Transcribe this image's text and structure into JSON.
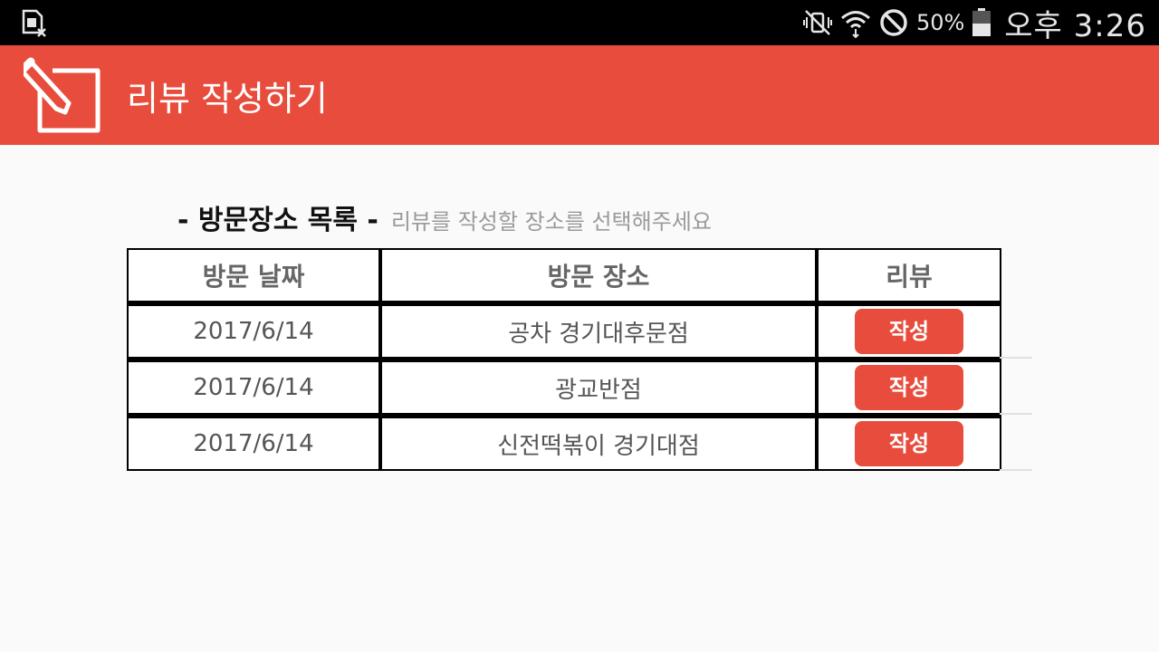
{
  "status_bar": {
    "battery_percent": "50%",
    "time": "오후 3:26",
    "icons": [
      "sim-card-missing-icon",
      "vibrate-mute-icon",
      "wifi-icon",
      "do-not-disturb-icon",
      "battery-icon"
    ]
  },
  "app_bar": {
    "title": "리뷰 작성하기",
    "icon": "edit-note-icon",
    "color": "#e84c3d"
  },
  "list": {
    "title": "- 방문장소 목록 -",
    "hint": "리뷰를 작성할 장소를 선택해주세요",
    "columns": [
      "방문 날짜",
      "방문 장소",
      "리뷰"
    ],
    "rows": [
      {
        "date": "2017/6/14",
        "place": "공차 경기대후문점",
        "action": "작성"
      },
      {
        "date": "2017/6/14",
        "place": "광교반점",
        "action": "작성"
      },
      {
        "date": "2017/6/14",
        "place": "신전떡볶이 경기대점",
        "action": "작성"
      }
    ]
  }
}
